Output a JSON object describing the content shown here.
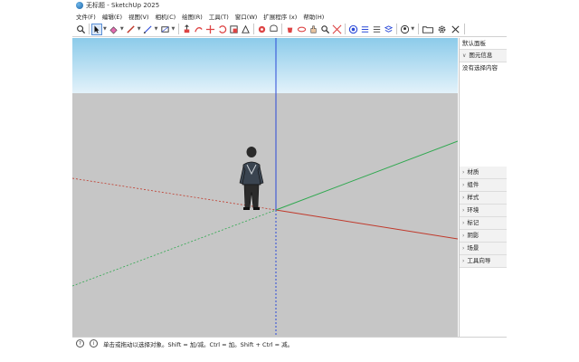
{
  "window": {
    "title": "无标题 - SketchUp 2025"
  },
  "menu": [
    "文件(F)",
    "编辑(E)",
    "视图(V)",
    "相机(C)",
    "绘图(R)",
    "工具(T)",
    "窗口(W)",
    "扩展程序 (x)",
    "帮助(H)"
  ],
  "toolbar": {
    "icons": [
      "search-icon",
      "select-arrow-icon",
      "eraser-icon",
      "pencil-icon",
      "line-icon",
      "rectangle-icon",
      "push-pull-icon",
      "move-icon",
      "rotate-icon",
      "scale-icon",
      "tape-measure-icon",
      "text-icon",
      "paint-bucket-icon",
      "orbit-icon",
      "pan-icon",
      "zoom-icon",
      "zoom-extents-icon",
      "warehouse-icon",
      "extension-icon",
      "account-icon",
      "folder-icon",
      "settings-icon",
      "close-icon"
    ]
  },
  "tray": {
    "title": "默认面板",
    "entity_info": "图元信息",
    "no_selection": "没有选择内容",
    "panels": [
      "材质",
      "组件",
      "样式",
      "环境",
      "标记",
      "阴影",
      "场景",
      "工具向导"
    ]
  },
  "status": {
    "hint": "单击或拖动以选择对象。Shift = 加/减。Ctrl = 加。Shift + Ctrl = 减。"
  },
  "colors": {
    "sky_top": "#8ccbea",
    "sky_bottom": "#e3f2fa",
    "ground": "#c6c6c6",
    "axis_red": "#c0392b",
    "axis_green": "#2fa84f",
    "axis_blue": "#2c4bd8"
  }
}
